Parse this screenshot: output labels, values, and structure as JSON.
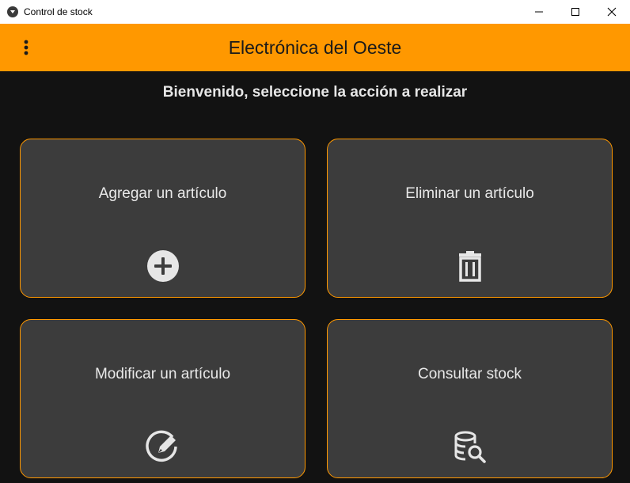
{
  "window": {
    "title": "Control de stock"
  },
  "appbar": {
    "title": "Electrónica del Oeste"
  },
  "main": {
    "subtitle": "Bienvenido, seleccione la acción a realizar",
    "actions": [
      {
        "label": "Agregar un artículo",
        "icon": "add-circle-icon"
      },
      {
        "label": "Eliminar un artículo",
        "icon": "trash-icon"
      },
      {
        "label": "Modificar un artículo",
        "icon": "edit-icon"
      },
      {
        "label": "Consultar stock",
        "icon": "database-search-icon"
      }
    ]
  },
  "colors": {
    "accent": "#ff9800",
    "background": "#121212",
    "card": "#3c3c3c",
    "text": "#e8e8e8"
  }
}
